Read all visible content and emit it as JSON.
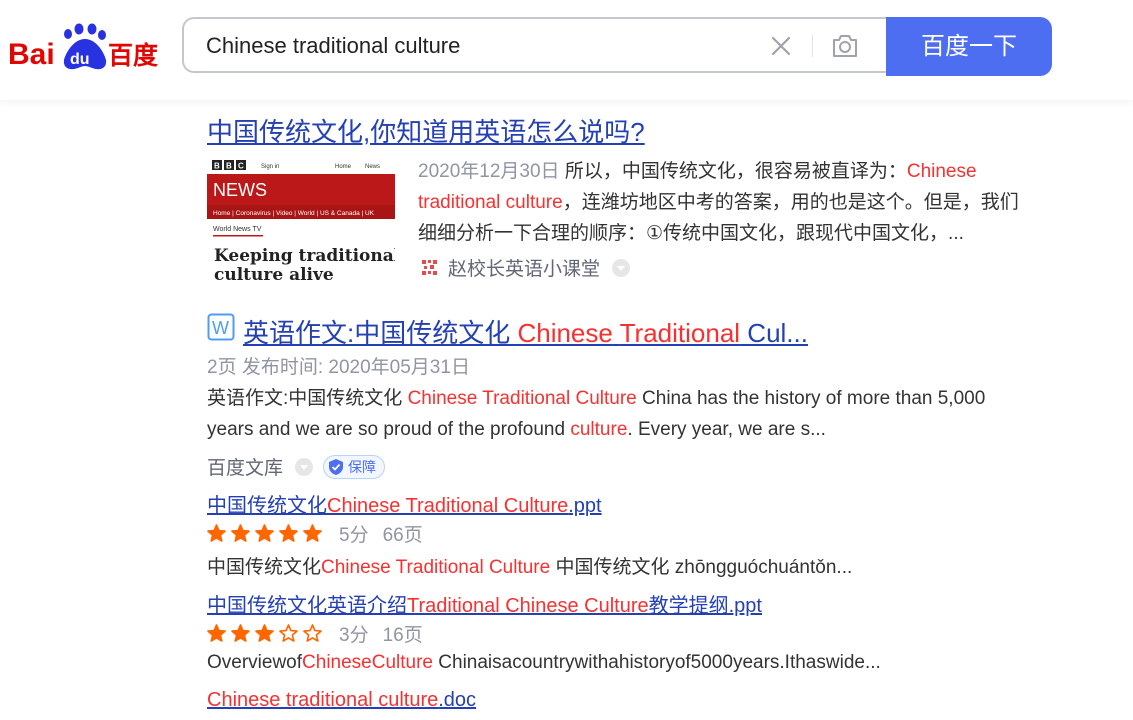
{
  "header": {
    "logo_text": "Bai du 百度",
    "search_value": "Chinese traditional culture",
    "search_button": "百度一下"
  },
  "results": [
    {
      "title": "中国传统文化,你知道用英语怎么说吗?",
      "thumbnail": {
        "brand": "BBC",
        "signin": "Sign in",
        "nav": [
          "Home",
          "News"
        ],
        "section": "NEWS",
        "menu": "Home | Coronavirus | Video | World | US & Canada | UK",
        "subsection": "World News TV",
        "headline": "Keeping traditional culture alive"
      },
      "date": "2020年12月30日",
      "abstract_pre": "所以，中国传统文化，很容易被直译为：",
      "abstract_hl": "Chinese traditional culture",
      "abstract_post": "，连潍坊地区中考的答案，用的也是这个。但是，我们细细分析一下合理的顺序：①传统中国文化，跟现代中国文化，...",
      "source": "赵校长英语小课堂"
    },
    {
      "title_pre": "英语作文:中国传统文化 ",
      "title_hl1": "Chinese",
      "title_mid": " ",
      "title_hl2": "Traditional",
      "title_post": " Cul...",
      "meta": "2页 发布时间: 2020年05月31日",
      "abstract_pre": "英语作文:中国传统文化 ",
      "abstract_hl1": "Chinese Traditional Culture",
      "abstract_mid": " China has the history of more than 5,000 years and we are so proud of the profound ",
      "abstract_hl2": "culture",
      "abstract_post": ". Every year, we are s...",
      "source": "百度文库",
      "badge": "保障",
      "sub_results": [
        {
          "title_pre": "中国传统文化",
          "title_hl": "Chinese Traditional Culture",
          "title_post": ".ppt",
          "score": "5分",
          "pages": "66页",
          "stars": 5,
          "snippet_pre": "中国传统文化",
          "snippet_hl": "Chinese Traditional Culture",
          "snippet_post": " 中国传统文化 zhōngguóchuántǒn..."
        },
        {
          "title_pre": "中国传统文化英语介绍",
          "title_hl": "Traditional Chinese Culture",
          "title_post": "教学提纲.ppt",
          "score": "3分",
          "pages": "16页",
          "stars": 3,
          "snippet_pre": "Overviewof",
          "snippet_hl": "ChineseCulture",
          "snippet_post": " Chinaisacountrywithahistoryof5000years.Ithaswide..."
        },
        {
          "title_pre": "",
          "title_hl": "Chinese traditional culture",
          "title_post": ".doc"
        }
      ]
    }
  ],
  "colors": {
    "accent": "#4e6ef2",
    "link": "#2440b3",
    "highlight": "#f73131",
    "star": "#ff6600",
    "meta": "#9195a3"
  }
}
